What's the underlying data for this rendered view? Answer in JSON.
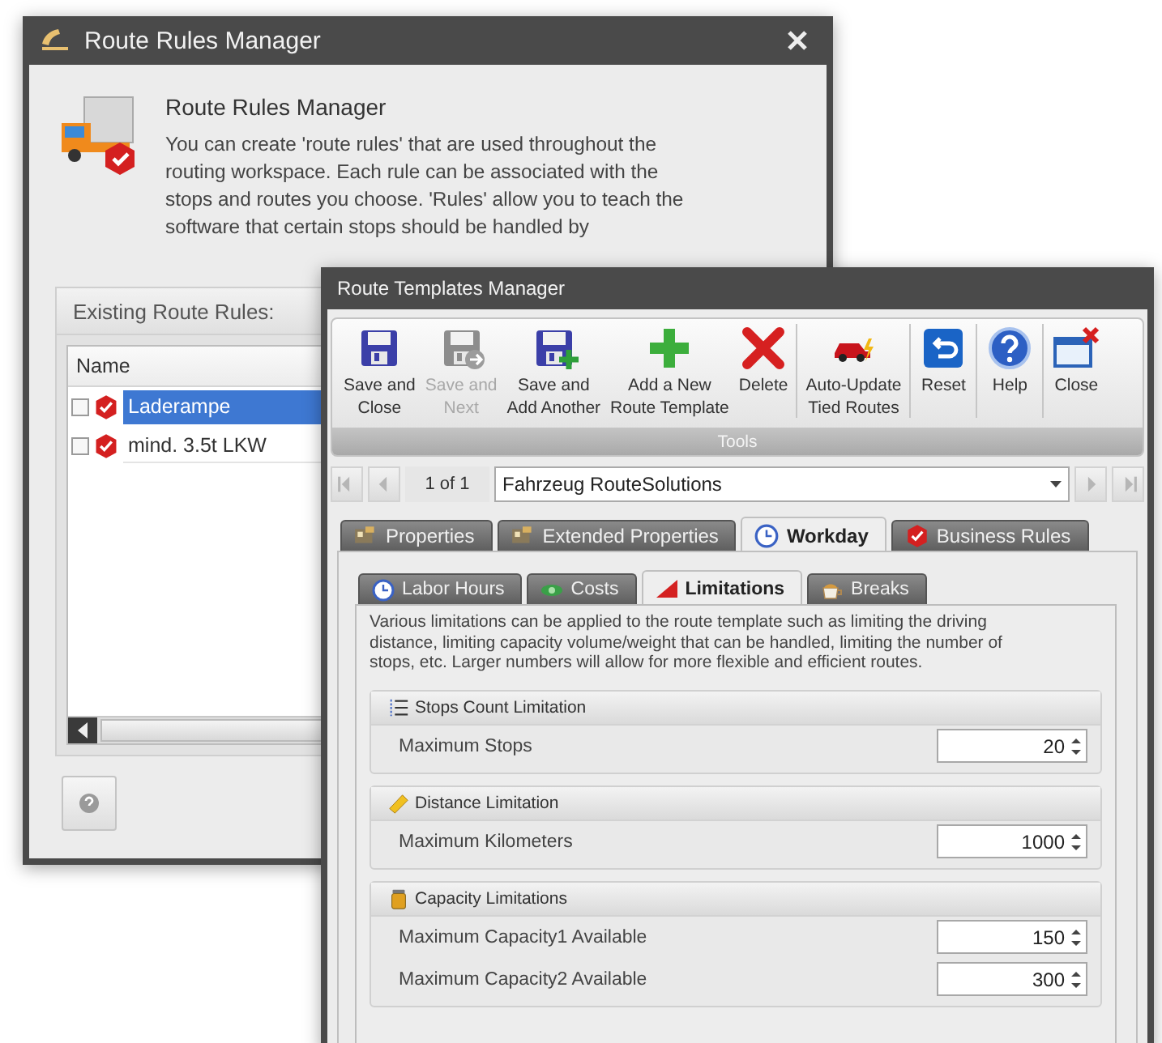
{
  "rules_window": {
    "title": "Route Rules Manager",
    "heading": "Route Rules Manager",
    "description": "You can create 'route rules' that are used throughout the routing workspace. Each rule can be associated with the stops and routes you choose. 'Rules' allow you to teach the software that certain stops should be handled by",
    "list_title": "Existing Route Rules:",
    "column": "Name",
    "rules": [
      {
        "name": "Laderampe",
        "checked": false,
        "selected": true
      },
      {
        "name": "mind. 3.5t LKW",
        "checked": false,
        "selected": false
      }
    ]
  },
  "templates_window": {
    "title": "Route Templates Manager",
    "toolbar": {
      "group_label": "Tools",
      "sections": [
        [
          {
            "lines": [
              "Save and",
              "Close"
            ],
            "disabled": false
          },
          {
            "lines": [
              "Save and",
              "Next"
            ],
            "disabled": true
          },
          {
            "lines": [
              "Save and",
              "Add Another"
            ],
            "disabled": false
          },
          {
            "lines": [
              "Add a New",
              "Route Template"
            ],
            "disabled": false
          },
          {
            "lines": [
              "Delete"
            ],
            "disabled": false
          }
        ],
        [
          {
            "lines": [
              "Auto-Update",
              "Tied Routes"
            ],
            "disabled": false
          }
        ],
        [
          {
            "lines": [
              "Reset"
            ],
            "disabled": false
          }
        ],
        [
          {
            "lines": [
              "Help"
            ],
            "disabled": false
          }
        ],
        [
          {
            "lines": [
              "Close"
            ],
            "disabled": false
          }
        ]
      ]
    },
    "navigator": {
      "position": "1 of 1",
      "record": "Fahrzeug RouteSolutions"
    },
    "tabs": [
      {
        "label": "Properties",
        "selected": false
      },
      {
        "label": "Extended Properties",
        "selected": false
      },
      {
        "label": "Workday",
        "selected": true
      },
      {
        "label": "Business Rules",
        "selected": false
      }
    ],
    "subtabs": [
      {
        "label": "Labor Hours",
        "selected": false
      },
      {
        "label": "Costs",
        "selected": false
      },
      {
        "label": "Limitations",
        "selected": true
      },
      {
        "label": "Breaks",
        "selected": false
      }
    ],
    "description": "Various limitations can be applied to the route template such as limiting the driving distance, limiting capacity volume/weight that can be handled, limiting the number of stops, etc. Larger numbers will allow for more flexible and efficient routes.",
    "groups": [
      {
        "title": "Stops Count Limitation",
        "fields": [
          {
            "label": "Maximum Stops",
            "value": "20"
          }
        ]
      },
      {
        "title": "Distance Limitation",
        "fields": [
          {
            "label": "Maximum Kilometers",
            "value": "1000"
          }
        ]
      },
      {
        "title": "Capacity Limitations",
        "fields": [
          {
            "label": "Maximum Capacity1 Available",
            "value": "150"
          },
          {
            "label": "Maximum Capacity2 Available",
            "value": "300"
          }
        ]
      }
    ]
  }
}
